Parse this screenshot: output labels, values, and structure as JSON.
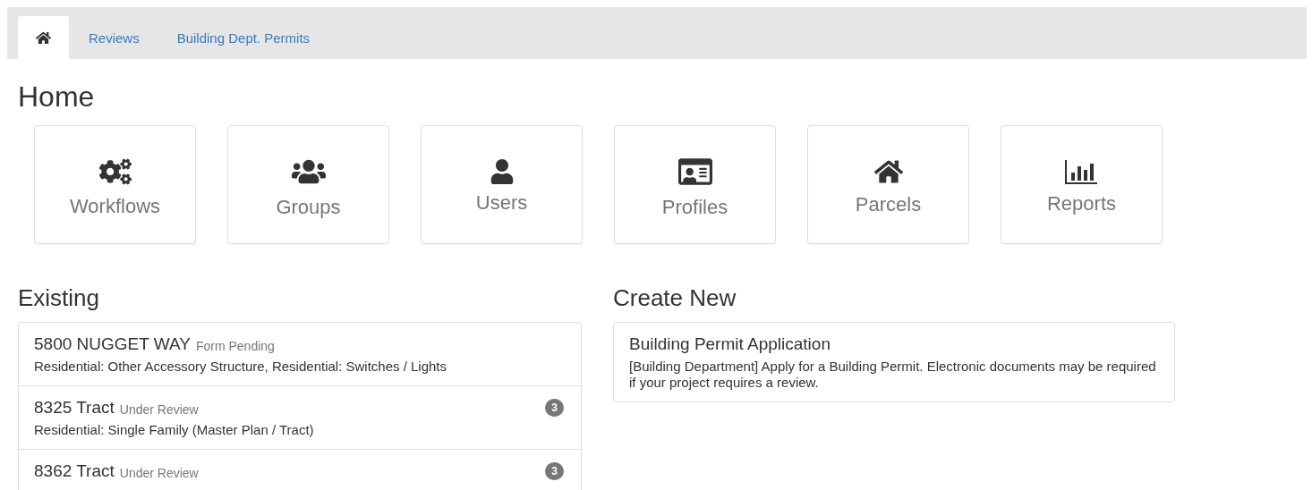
{
  "tabs": [
    {
      "kind": "home",
      "selected": true
    },
    {
      "kind": "text",
      "label": "Reviews",
      "selected": false
    },
    {
      "kind": "text",
      "label": "Building Dept. Permits",
      "selected": false
    }
  ],
  "page_title": "Home",
  "tiles": [
    {
      "label": "Workflows"
    },
    {
      "label": "Groups"
    },
    {
      "label": "Users"
    },
    {
      "label": "Profiles"
    },
    {
      "label": "Parcels"
    },
    {
      "label": "Reports"
    }
  ],
  "existing": {
    "heading": "Existing",
    "items": [
      {
        "title": "5800 NUGGET WAY",
        "status": "Form Pending",
        "description": "Residential: Other Accessory Structure, Residential: Switches / Lights"
      },
      {
        "title": "8325 Tract",
        "status": "Under Review",
        "badge": "3",
        "description": "Residential: Single Family (Master Plan / Tract)"
      },
      {
        "title": "8362 Tract",
        "status": "Under Review",
        "badge": "3"
      }
    ]
  },
  "create_new": {
    "heading": "Create New",
    "items": [
      {
        "title": "Building Permit Application",
        "description": "[Building Department] Apply for a Building Permit. Electronic documents may be required if your project requires a review."
      }
    ]
  }
}
